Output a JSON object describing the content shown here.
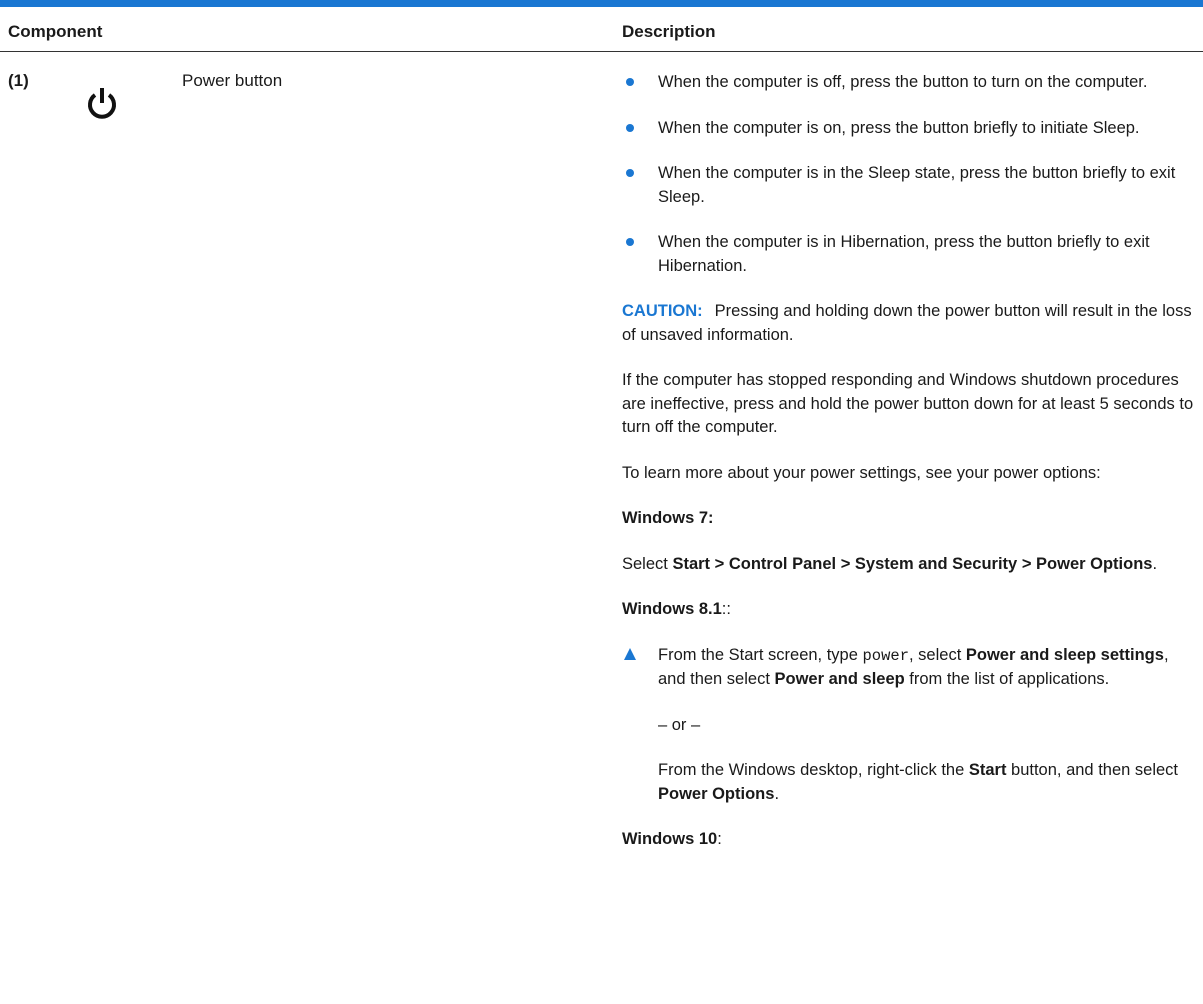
{
  "header": {
    "component_label": "Component",
    "description_label": "Description"
  },
  "row": {
    "number": "(1)",
    "icon": "power-icon",
    "name": "Power button"
  },
  "bullets": [
    "When the computer is off, press the button to turn on the computer.",
    "When the computer is on, press the button briefly to initiate Sleep.",
    "When the computer is in the Sleep state, press the button briefly to exit Sleep.",
    "When the computer is in Hibernation, press the button briefly to exit Hibernation."
  ],
  "caution": {
    "label": "CAUTION:",
    "text": "Pressing and holding down the power button will result in the loss of unsaved information."
  },
  "para_unresponsive": "If the computer has stopped responding and Windows shutdown procedures are ineffective, press and hold the power button down for at least 5 seconds to turn off the computer.",
  "para_learn": "To learn more about your power settings, see your power options:",
  "win7": {
    "heading": "Windows 7:",
    "select_prefix": "Select ",
    "path": "Start > Control Panel > System and Security > Power Options",
    "period": "."
  },
  "win81": {
    "heading": "Windows 8.1",
    "heading_suffix": "::",
    "step_part1": "From the Start screen, type ",
    "step_code": "power",
    "step_part2": ", select ",
    "step_bold1": "Power and sleep settings",
    "step_part3": ", and then select ",
    "step_bold2": "Power and sleep",
    "step_part4": " from the list of applications.",
    "or_text": "– or –",
    "alt_part1": "From the Windows desktop, right-click the ",
    "alt_bold1": "Start",
    "alt_part2": " button, and then select ",
    "alt_bold2": "Power Options",
    "alt_part3": "."
  },
  "win10": {
    "heading": "Windows 10",
    "suffix": ":"
  },
  "colors": {
    "accent": "#1a77d2",
    "text": "#1a1a1a"
  }
}
